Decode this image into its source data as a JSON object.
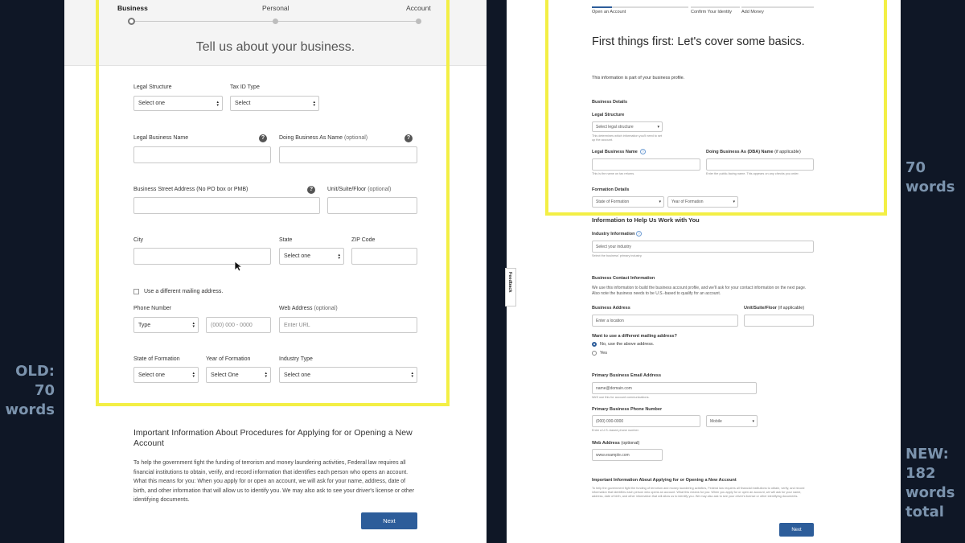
{
  "labels": {
    "old": "OLD:\n70\nwords",
    "new_top": "70\nwords",
    "new_bottom": "NEW:\n182\nwords\ntotal"
  },
  "old_form": {
    "steps": [
      "Business",
      "Personal",
      "Account"
    ],
    "heading": "Tell us about your business.",
    "legal_structure": {
      "label": "Legal Structure",
      "value": "Select one"
    },
    "tax_id": {
      "label": "Tax ID Type",
      "value": "Select"
    },
    "legal_name": {
      "label": "Legal Business Name"
    },
    "dba": {
      "label": "Doing Business As Name",
      "optional": "(optional)"
    },
    "street": {
      "label": "Business Street Address (No PO box or PMB)"
    },
    "unit": {
      "label": "Unit/Suite/Floor",
      "optional": "(optional)"
    },
    "city": {
      "label": "City"
    },
    "state": {
      "label": "State",
      "value": "Select one"
    },
    "zip": {
      "label": "ZIP Code"
    },
    "mailing": {
      "label": "Use a different mailing address."
    },
    "phone": {
      "label": "Phone Number",
      "type_value": "Type",
      "placeholder": "(000) 000 - 0000"
    },
    "web": {
      "label": "Web Address",
      "optional": "(optional)",
      "placeholder": "Enter URL"
    },
    "state_formation": {
      "label": "State of Formation",
      "value": "Select one"
    },
    "year_formation": {
      "label": "Year of Formation",
      "value": "Select One"
    },
    "industry": {
      "label": "Industry Type",
      "value": "Select one"
    },
    "info_title": "Important Information About Procedures for Applying for or Opening a New Account",
    "info_body": "To help the government fight the funding of terrorism and money laundering activities, Federal law requires all financial institutions to obtain, verify, and record information that identifies each person who opens an account. What this means for you: When you apply for or open an account, we will ask for your name, address, date of birth, and other information that will allow us to identify you. We may also ask to see your driver's license or other identifying documents.",
    "next": "Next"
  },
  "new_form": {
    "tabs": [
      "Open an Account",
      "Confirm Your Identity",
      "Add Money"
    ],
    "heading": "First things first: Let's cover some basics.",
    "intro": "This information is part of your business profile.",
    "business_details": "Business Details",
    "legal_structure": {
      "label": "Legal Structure",
      "value": "Select legal structure",
      "help": "This determines which information you'll need to set up the account."
    },
    "legal_name": {
      "label": "Legal Business Name",
      "help": "This is the name on tax returns."
    },
    "dba": {
      "label": "Doing Business As (DBA) Name",
      "optional": "(if applicable)",
      "help": "Enter the public-facing name. This appears on any checks you order."
    },
    "formation_details": "Formation Details",
    "state_formation": "State of Formation",
    "year_formation": "Year of Formation",
    "work_heading": "Information to Help Us Work with You",
    "industry": {
      "label": "Industry Information",
      "placeholder": "Select your industry",
      "help": "Select the business' primary industry."
    },
    "contact_heading": "Business Contact Information",
    "contact_intro": "We use this information to build the business account profile, and we'll ask for your contact information on the next page. Also note the business needs to be U.S.-based to qualify for an account.",
    "address": {
      "label": "Business Address",
      "placeholder": "Enter a location"
    },
    "unit": {
      "label": "Unit/Suite/Floor",
      "optional": "(if applicable)"
    },
    "mailing_q": "Want to use a different mailing address?",
    "mailing_no": "No, use the above address.",
    "mailing_yes": "Yes",
    "email": {
      "label": "Primary Business Email Address",
      "placeholder": "name@domain.com",
      "help": "We'll use this for account communications."
    },
    "phone": {
      "label": "Primary Business Phone Number",
      "placeholder": "(000) 000-0000",
      "type_value": "Mobile",
      "help": "Enter a U.S.-based phone number."
    },
    "web": {
      "label": "Web Address",
      "optional": "(optional)",
      "placeholder": "www.example.com"
    },
    "info_title": "Important Information About Applying for or Opening a New Account",
    "info_body": "To help the government fight the funding of terrorism and money laundering activities, Federal law requires all financial institutions to obtain, verify, and record information that identifies each person who opens an account. What this means for you: When you apply for or open an account, we will ask for your name, address, date of birth, and other information that will allow us to identify you. We may also ask to see your driver's license or other identifying documents.",
    "next": "Next",
    "feedback": "Feedback"
  },
  "colors": {
    "highlight": "#f3ef45",
    "button": "#2d5d9a",
    "background": "#0f1726",
    "side_text": "#7b93ad"
  }
}
